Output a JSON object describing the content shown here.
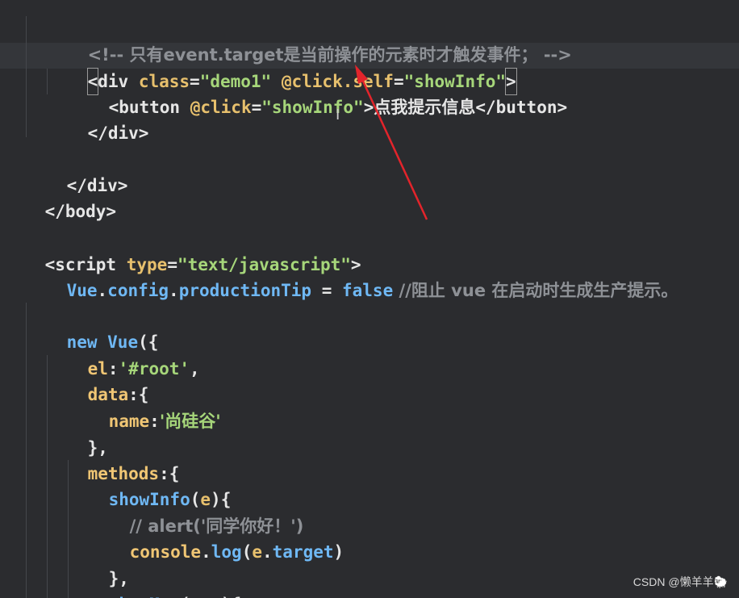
{
  "code": {
    "l1": {
      "comment": "<!-- 只有event.target是当前操作的元素时才触发事件； -->"
    },
    "l2": {
      "open": "<div ",
      "attr1": "class",
      "eq1": "=",
      "val1": "\"demo1\"",
      "attr2": "@click.self",
      "eq2": "=",
      "val2": "\"showInfo\"",
      "close": ">"
    },
    "l3": {
      "open": "<button ",
      "attr1": "@click",
      "eq1": "=",
      "val1": "\"showInfo\"",
      "close": ">",
      "text": "点我提示信息",
      "end": "</button>"
    },
    "l4": {
      "text": "</div>"
    },
    "l6": {
      "text": "</div>"
    },
    "l7": {
      "text": "</body>"
    },
    "l9": {
      "open": "<script ",
      "attr1": "type",
      "eq1": "=",
      "val1": "\"text/javascript\"",
      "close": ">"
    },
    "l10": {
      "obj": "Vue",
      "dot1": ".",
      "p1": "config",
      "dot2": ".",
      "p2": "productionTip",
      "eq": " = ",
      "kw": "false",
      "comment": " //阻止 vue 在启动时生成生产提示。"
    },
    "l12": {
      "kw": "new ",
      "obj": "Vue",
      "rest": "({"
    },
    "l13": {
      "key": "el",
      "colon": ":",
      "val": "'#root'",
      "comma": ","
    },
    "l14": {
      "key": "data",
      "rest": ":{"
    },
    "l15": {
      "key": "name",
      "colon": ":",
      "val": "'尚硅谷'"
    },
    "l16": {
      "text": "},"
    },
    "l17": {
      "key": "methods",
      "rest": ":{"
    },
    "l18": {
      "fn": "showInfo",
      "open": "(",
      "arg": "e",
      "close": "){"
    },
    "l19": {
      "comment": "// alert('同学你好！')"
    },
    "l20": {
      "obj": "console",
      "dot": ".",
      "fn": "log",
      "open": "(",
      "arg": "e",
      "dot2": ".",
      "prop": "target",
      "close": ")"
    },
    "l21": {
      "text": "},"
    },
    "l22": {
      "fn": "showMsg",
      "open": "(",
      "arg": "msg",
      "close": "){"
    }
  },
  "overlay": {
    "ibeam": "I",
    "watermark": "CSDN @懒羊羊🐑"
  },
  "colors": {
    "background": "#2b2c2f",
    "current_line": "#34363a",
    "arrow": "#e3242b",
    "string": "#a6d67a",
    "attribute": "#e7c06d",
    "keyword": "#6fb8f4",
    "comment": "#8e9196"
  }
}
